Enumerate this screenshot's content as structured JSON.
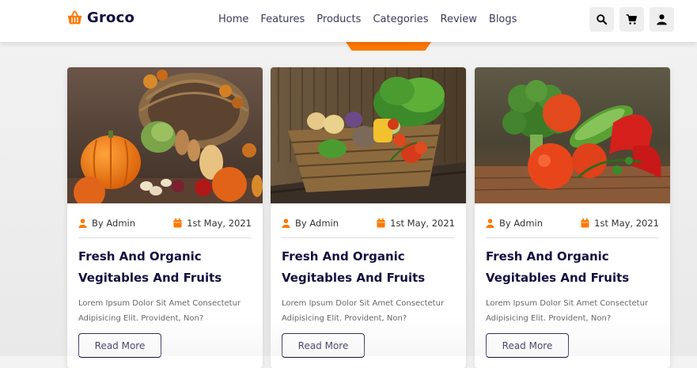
{
  "header": {
    "logo": {
      "text": "Groco",
      "icon": "basket-icon"
    },
    "nav": [
      "Home",
      "Features",
      "Products",
      "Categories",
      "Review",
      "Blogs"
    ],
    "icons": [
      "search-icon",
      "cart-icon",
      "user-icon"
    ]
  },
  "cards": [
    {
      "author": "By Admin",
      "date": "1st May, 2021",
      "title_line1": "Fresh And Organic",
      "title_line2": "Vegitables And Fruits",
      "desc_line1": "Lorem Ipsum Dolor Sit Amet Consectetur",
      "desc_line2": "Adipisicing Elit. Provident, Non?",
      "button": "Read More",
      "image": "basket-of-autumn-vegetables-with-pumpkins"
    },
    {
      "author": "By Admin",
      "date": "1st May, 2021",
      "title_line1": "Fresh And Organic",
      "title_line2": "Vegitables And Fruits",
      "desc_line1": "Lorem Ipsum Dolor Sit Amet Consectetur",
      "desc_line2": "Adipisicing Elit. Provident, Non?",
      "button": "Read More",
      "image": "wicker-basket-of-vegetables-with-lettuce"
    },
    {
      "author": "By Admin",
      "date": "1st May, 2021",
      "title_line1": "Fresh And Organic",
      "title_line2": "Vegitables And Fruits",
      "desc_line1": "Lorem Ipsum Dolor Sit Amet Consectetur",
      "desc_line2": "Adipisicing Elit. Provident, Non?",
      "button": "Read More",
      "image": "broccoli-tomatoes-cucumber-peppers"
    }
  ],
  "colors": {
    "accent": "#ff7800",
    "text": "#130f40"
  }
}
